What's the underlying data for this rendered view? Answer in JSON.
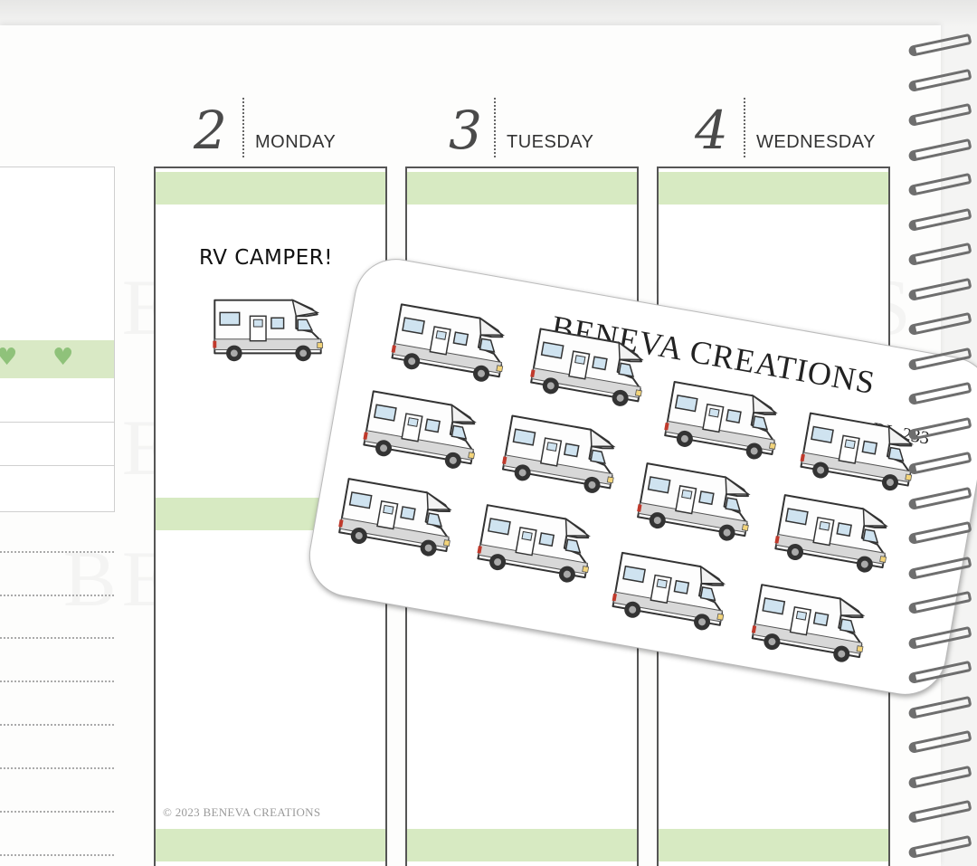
{
  "days": [
    {
      "number": "2",
      "name": "MONDAY"
    },
    {
      "number": "3",
      "name": "TUESDAY"
    },
    {
      "number": "4",
      "name": "WEDNESDAY"
    }
  ],
  "sticker_label": "RV CAMPER!",
  "copyright": "© 2023  BENEVA CREATIONS",
  "watermark": "BENEVA CREATIONS",
  "sheet": {
    "brand": "BENEVA CREATIONS",
    "code": "DL-233"
  },
  "icons": {
    "sticker": "rv-camper-icon",
    "heart": "heart-icon",
    "binding": "spiral-ring-icon"
  },
  "colors": {
    "green_band": "#d7eac2",
    "heart": "#8fc27a",
    "column_border": "#555555"
  }
}
